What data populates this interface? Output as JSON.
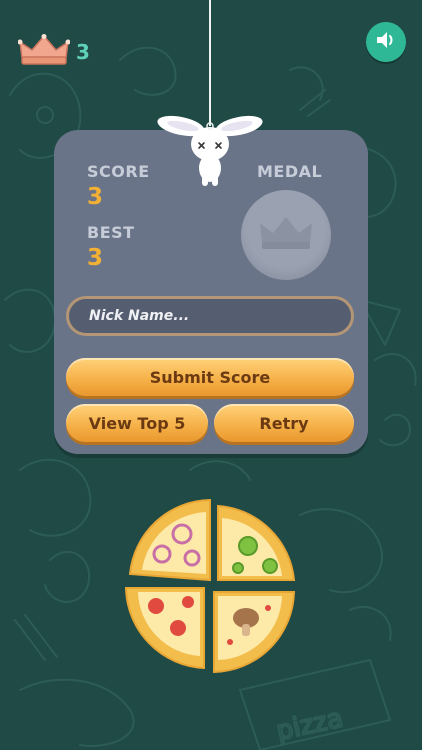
{
  "header": {
    "crown_count": "3"
  },
  "panel": {
    "score_label": "SCORE",
    "score_value": "3",
    "best_label": "BEST",
    "best_value": "3",
    "medal_label": "MEDAL",
    "nickname": {
      "value": "",
      "placeholder": "Nick Name..."
    },
    "submit_label": "Submit Score",
    "view_top_label": "View Top 5",
    "retry_label": "Retry"
  },
  "icons": {
    "crown": "crown-icon",
    "sound": "speaker-icon",
    "medal": "crown-medal-icon",
    "pizza": "pizza-icon",
    "bunny": "bunny-icon"
  },
  "colors": {
    "background": "#1f4a45",
    "panel": "#6a7488",
    "accent_value": "#f2b134",
    "button_orange": "#f6b24a",
    "crown_count": "#5fd1b9",
    "sound_button": "#2fb896"
  }
}
